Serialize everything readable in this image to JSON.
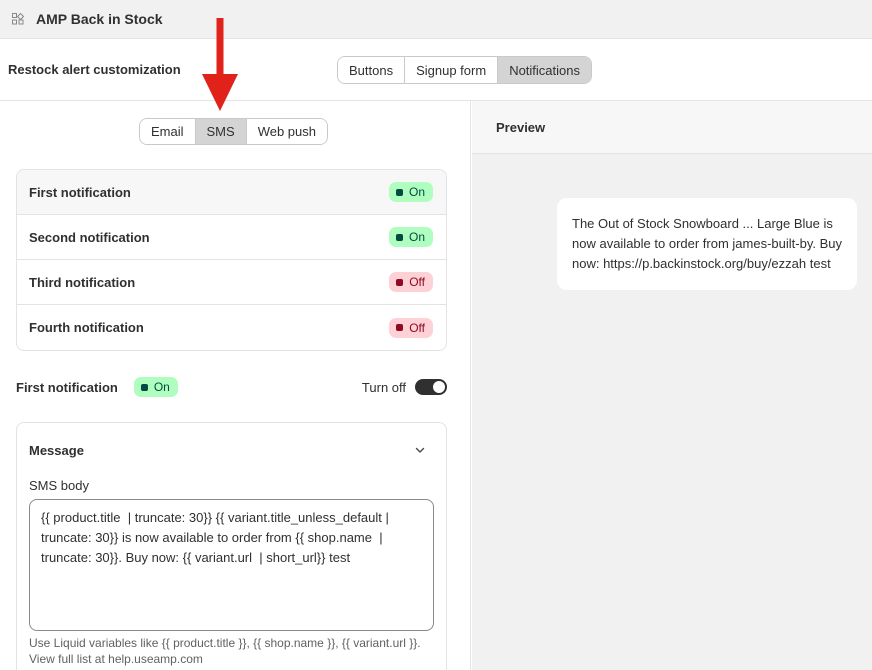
{
  "app": {
    "title": "AMP Back in Stock",
    "icon": "app-grid-icon"
  },
  "header": {
    "title": "Restock alert customization",
    "tabs": [
      {
        "label": "Buttons",
        "active": false
      },
      {
        "label": "Signup form",
        "active": false
      },
      {
        "label": "Notifications",
        "active": true
      }
    ]
  },
  "channels": [
    {
      "label": "Email",
      "active": false
    },
    {
      "label": "SMS",
      "active": true
    },
    {
      "label": "Web push",
      "active": false
    }
  ],
  "notifications": [
    {
      "name": "First notification",
      "status": "On",
      "state": "on",
      "selected": true
    },
    {
      "name": "Second notification",
      "status": "On",
      "state": "on",
      "selected": false
    },
    {
      "name": "Third notification",
      "status": "Off",
      "state": "off",
      "selected": false
    },
    {
      "name": "Fourth notification",
      "status": "Off",
      "state": "off",
      "selected": false
    }
  ],
  "selected": {
    "title": "First notification",
    "status": "On",
    "toggle_label": "Turn off",
    "toggle_on": true
  },
  "message": {
    "heading": "Message",
    "field_label": "SMS body",
    "body": "{{ product.title  | truncate: 30}} {{ variant.title_unless_default | truncate: 30}} is now available to order from {{ shop.name  | truncate: 30}}. Buy now: {{ variant.url  | short_url}} test",
    "help": "Use Liquid variables like {{ product.title }}, {{ shop.name }}, {{ variant.url }}. View full list at help.useamp.com"
  },
  "preview": {
    "heading": "Preview",
    "text": "The Out of Stock Snowboard ... Large Blue is now available to order from james-built-by. Buy now: https://p.backinstock.org/buy/ezzah test"
  },
  "colors": {
    "accent_arrow": "#e0221b",
    "on_badge_bg": "#affebf",
    "off_badge_bg": "#fed1d7",
    "active_segment": "#d4d4d4"
  }
}
